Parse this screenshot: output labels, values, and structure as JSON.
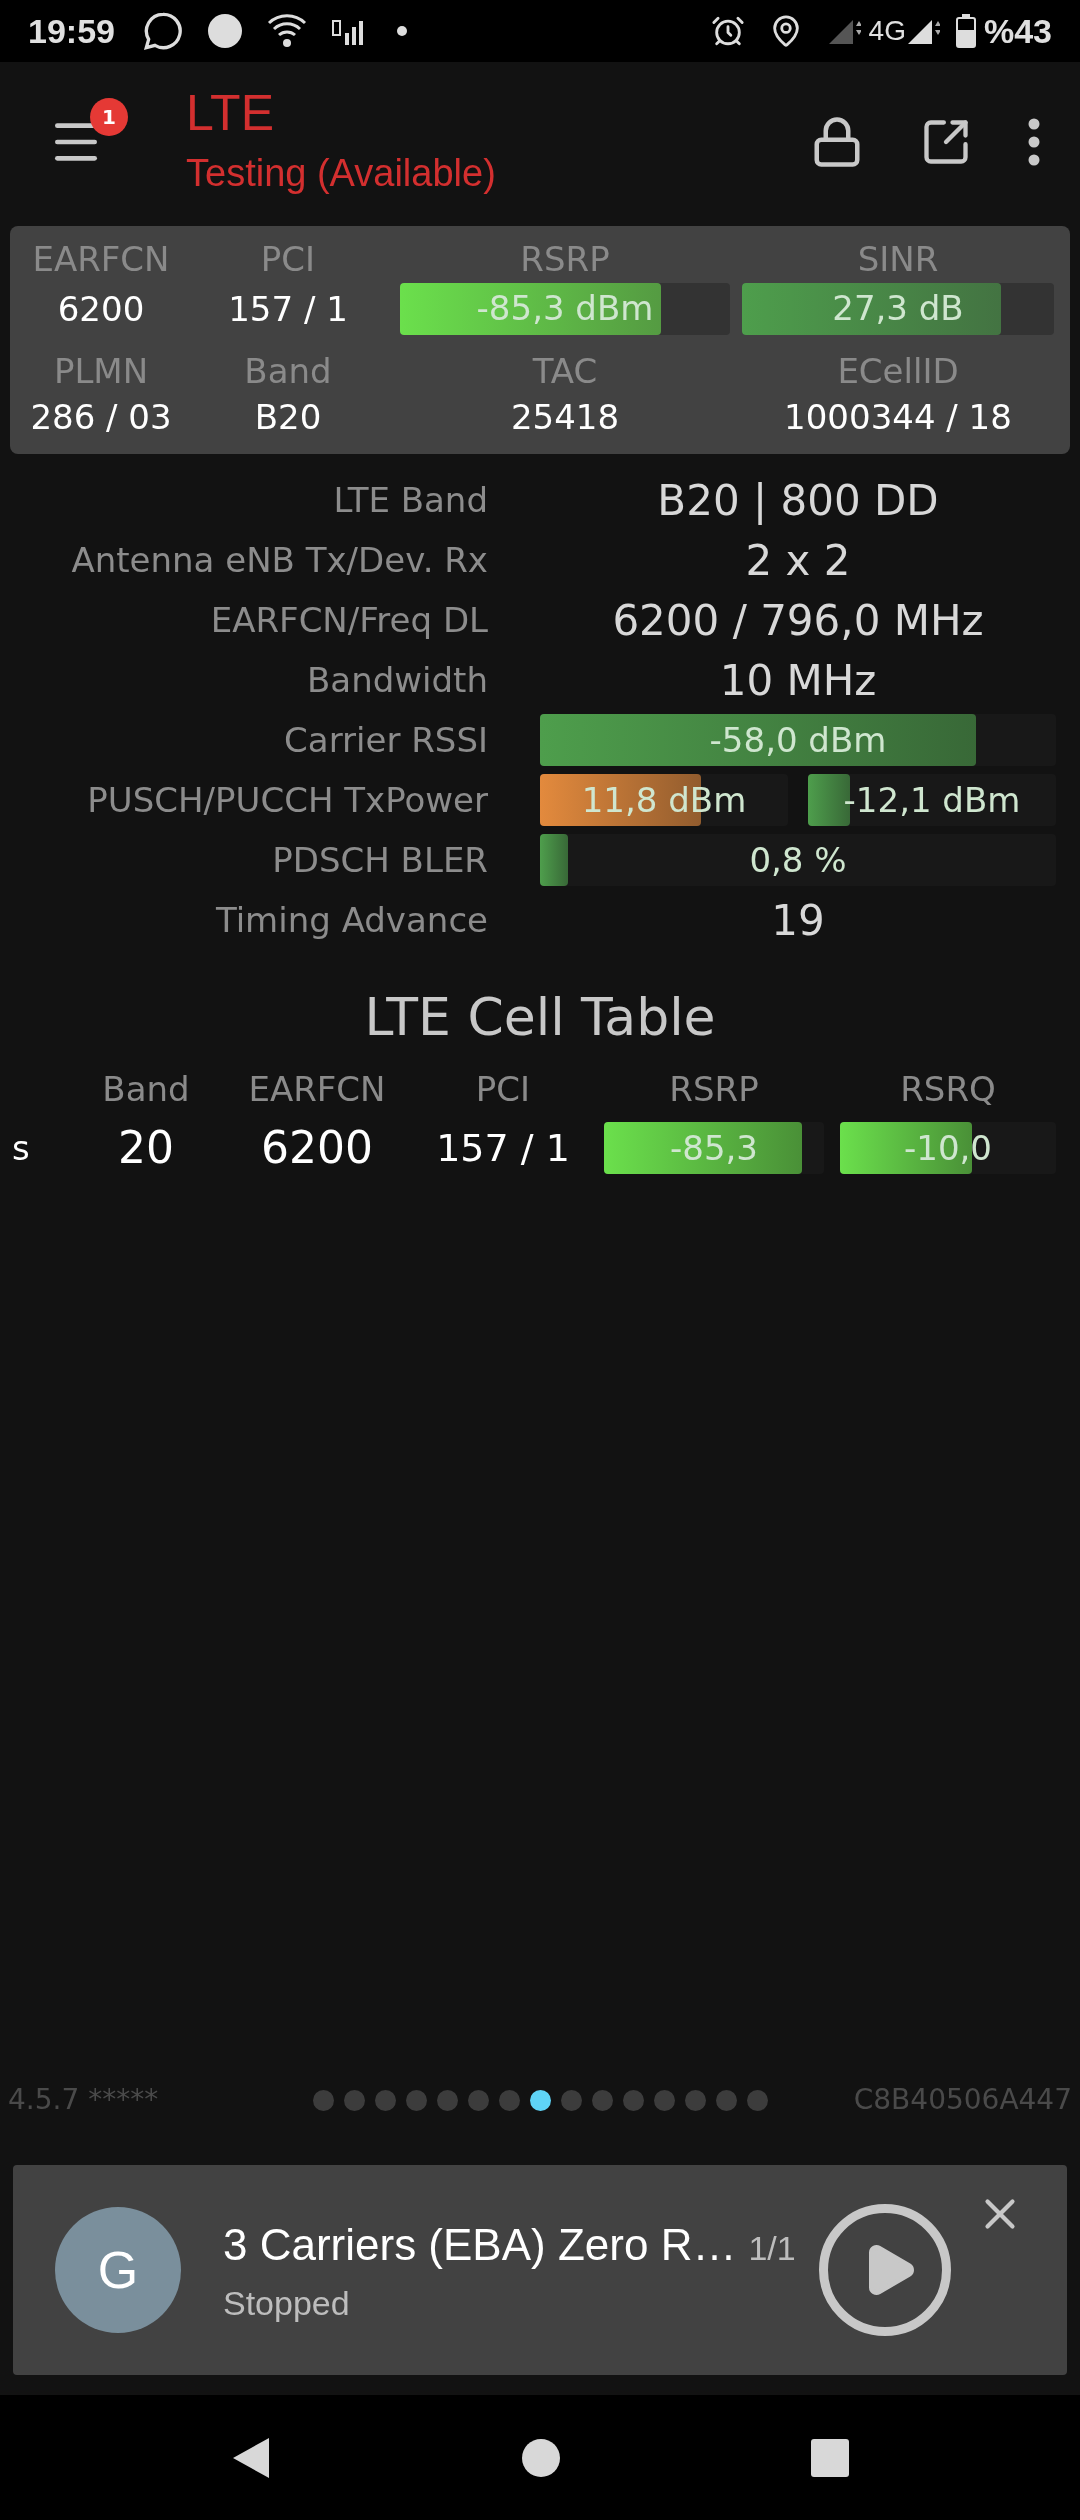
{
  "status_bar": {
    "time": "19:59",
    "network": "4G",
    "battery": "%43"
  },
  "header": {
    "badge": "1",
    "title": "LTE",
    "subtitle": "Testing (Available)"
  },
  "summary": {
    "row1": [
      {
        "label": "EARFCN",
        "value": "6200",
        "kind": "text"
      },
      {
        "label": "PCI",
        "value": "157 / 1",
        "kind": "text"
      },
      {
        "label": "RSRP",
        "value": "-85,3 dBm",
        "kind": "bar",
        "level": 0.79,
        "color": "#6be04c"
      },
      {
        "label": "SINR",
        "value": "27,3 dB",
        "kind": "bar",
        "level": 0.83,
        "color": "#4e9e4c"
      }
    ],
    "row2": [
      {
        "label": "PLMN",
        "value": "286 / 03"
      },
      {
        "label": "Band",
        "value": "B20"
      },
      {
        "label": "TAC",
        "value": "25418"
      },
      {
        "label": "ECellID",
        "value": "1000344 / 18"
      }
    ]
  },
  "details": [
    {
      "label": "LTE Band",
      "kind": "text",
      "value": "B20 | 800 DD"
    },
    {
      "label": "Antenna eNB Tx/Dev. Rx",
      "kind": "text",
      "value": "2 x 2"
    },
    {
      "label": "EARFCN/Freq DL",
      "kind": "text",
      "value": "6200 / 796,0 MHz"
    },
    {
      "label": "Bandwidth",
      "kind": "text",
      "value": "10 MHz"
    },
    {
      "label": "Carrier RSSI",
      "kind": "bar",
      "bars": [
        {
          "value": "-58,0 dBm",
          "level": 0.845,
          "color": "#4e9e4c"
        }
      ]
    },
    {
      "label": "PUSCH/PUCCH TxPower",
      "kind": "bar",
      "bars": [
        {
          "value": "11,8 dBm",
          "level": 0.65,
          "color": "#e38a3d"
        },
        {
          "value": "-12,1 dBm",
          "level": 0.17,
          "color": "#4e9e4c"
        }
      ]
    },
    {
      "label": "PDSCH BLER",
      "kind": "bar",
      "bars": [
        {
          "value": "0,8 %",
          "level": 0.055,
          "color": "#4e9e4c"
        }
      ]
    },
    {
      "label": "Timing Advance",
      "kind": "text",
      "value": "19"
    }
  ],
  "cell_table": {
    "title": "LTE Cell Table",
    "columns": [
      "Band",
      "EARFCN",
      "PCI",
      "RSRP",
      "RSRQ"
    ],
    "rows": [
      {
        "type": "s",
        "band": "20",
        "earfcn": "6200",
        "pci": "157 / 1",
        "rsrp": {
          "value": "-85,3",
          "level": 0.9
        },
        "rsrq": {
          "value": "-10,0",
          "level": 0.61
        }
      }
    ]
  },
  "footer": {
    "version": "4.5.7 *****",
    "device_id": "C8B40506A447",
    "pages": [
      {
        "selected": false
      },
      {
        "selected": false
      },
      {
        "selected": false
      },
      {
        "selected": false
      },
      {
        "selected": false
      },
      {
        "selected": false
      },
      {
        "selected": false
      },
      {
        "selected": true
      },
      {
        "selected": false
      },
      {
        "selected": false
      },
      {
        "selected": false
      },
      {
        "selected": false
      },
      {
        "selected": false
      },
      {
        "selected": false
      },
      {
        "selected": false
      }
    ]
  },
  "player": {
    "avatar": "G",
    "title": "3 Carriers (EBA) Zero R…",
    "count": "1/1",
    "status": "Stopped"
  }
}
